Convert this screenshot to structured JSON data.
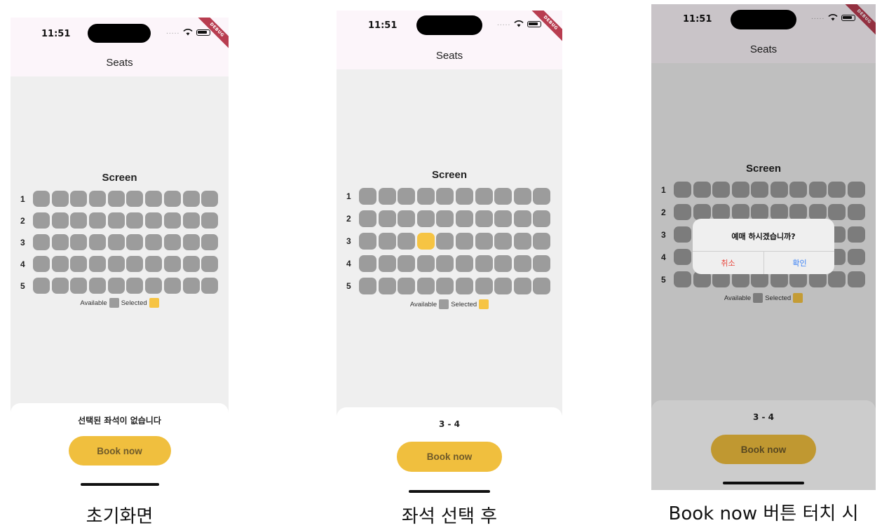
{
  "status": {
    "time": "11:51"
  },
  "debug_label": "DEBUG",
  "appbar_title": "Seats",
  "screen_label": "Screen",
  "row_labels": [
    "1",
    "2",
    "3",
    "4",
    "5"
  ],
  "legend": {
    "available": "Available",
    "selected": "Selected"
  },
  "book_button": "Book now",
  "phone1": {
    "selection_text": "선택된 좌석이 없습니다",
    "caption": "초기화면"
  },
  "phone2": {
    "selection_text": "3 - 4",
    "selected_seat": {
      "row": 3,
      "col": 4
    },
    "caption": "좌석 선택 후"
  },
  "phone3": {
    "selection_text": "3 - 4",
    "selected_seat": {
      "row": 3,
      "col": 4
    },
    "caption": "Book now 버튼 터치 시",
    "dialog": {
      "title": "예매 하시겠습니까?",
      "cancel": "취소",
      "confirm": "확인"
    }
  },
  "colors": {
    "seat_available": "#9c9c9c",
    "seat_selected": "#f6c443",
    "book_button": "#f0bf3e",
    "appbar": "#fcf5fa",
    "cancel": "#e8463c",
    "confirm": "#3b82f6"
  },
  "seats_per_row": 10
}
